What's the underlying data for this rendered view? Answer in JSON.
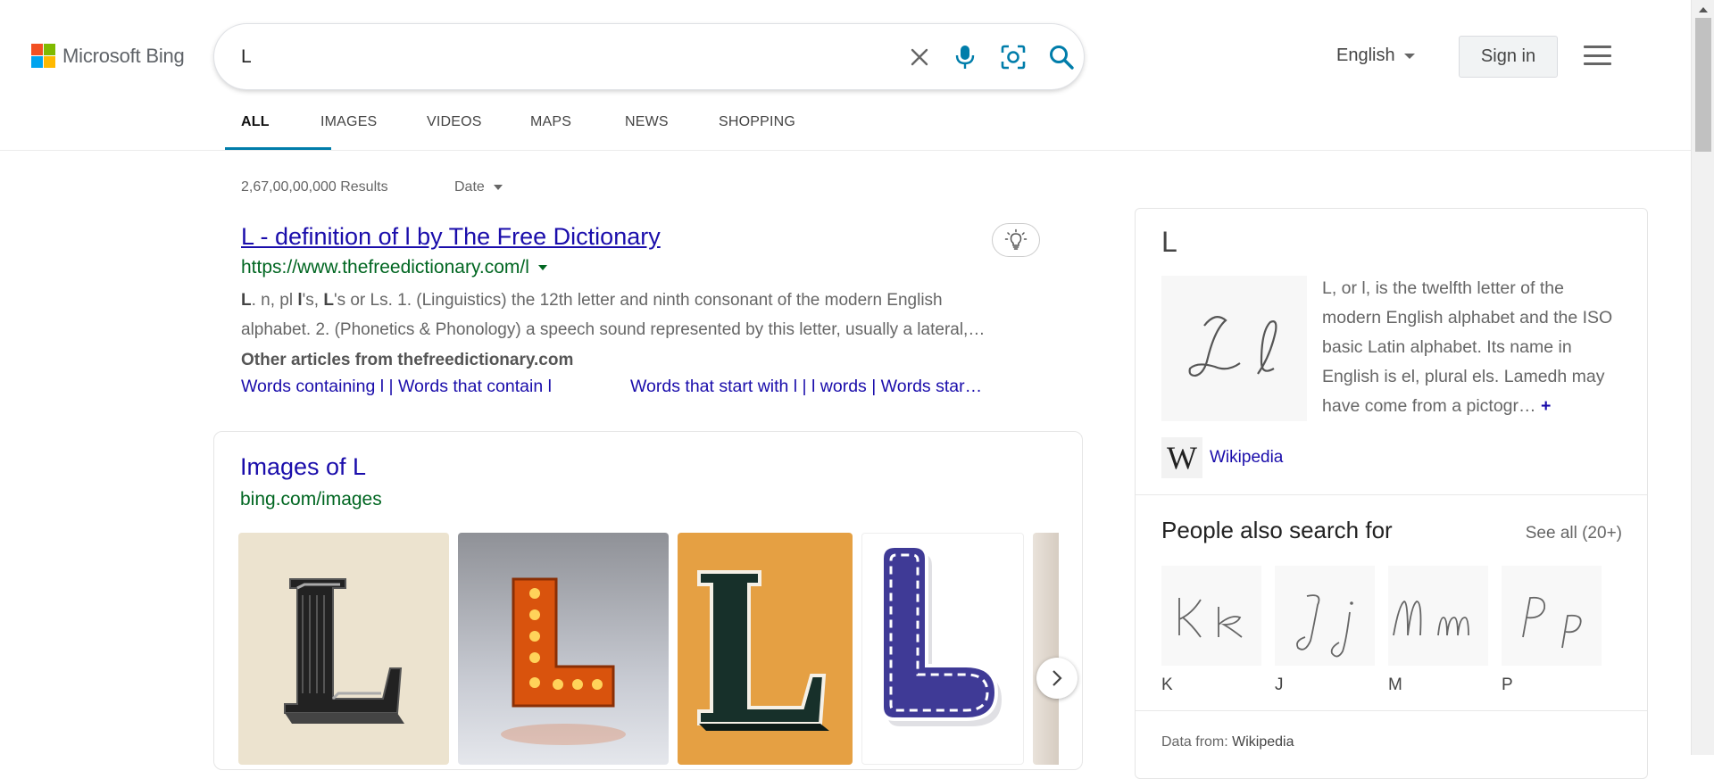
{
  "brand": {
    "name": "Microsoft Bing",
    "colors": [
      "#f25022",
      "#7fba00",
      "#00a4ef",
      "#ffb900"
    ]
  },
  "search": {
    "query": "L",
    "clear_icon": "close-icon",
    "mic_icon": "microphone-icon",
    "visual_icon": "visual-search-icon",
    "search_icon": "search-icon"
  },
  "header": {
    "language": "English",
    "signin": "Sign in",
    "menu_icon": "hamburger-menu-icon"
  },
  "tabs": [
    {
      "label": "ALL",
      "active": true
    },
    {
      "label": "IMAGES",
      "active": false
    },
    {
      "label": "VIDEOS",
      "active": false
    },
    {
      "label": "MAPS",
      "active": false
    },
    {
      "label": "NEWS",
      "active": false
    },
    {
      "label": "SHOPPING",
      "active": false
    }
  ],
  "results": {
    "count": "2,67,00,00,000 Results",
    "date_filter": "Date",
    "first": {
      "title": "L - definition of l by The Free Dictionary",
      "url": "https://www.thefreedictionary.com/l",
      "snippet_line1_a": "L",
      "snippet_line1_b": ". n, pl ",
      "snippet_line1_c": "l",
      "snippet_line1_d": "'s, ",
      "snippet_line1_e": "L",
      "snippet_line1_f": "'s or Ls. 1. (Linguistics) the 12th letter and ninth consonant of the modern English",
      "snippet_line2": "alphabet. 2. (Phonetics & Phonology) a speech sound represented by this letter, usually a lateral,…",
      "other_heading": "Other articles from thefreedictionary.com",
      "other_link1": "Words containing l | Words that contain l",
      "other_link2": "Words that start with l | l words | Words star…",
      "bulb_icon": "lightbulb-icon"
    },
    "images": {
      "title": "Images of L",
      "url": "bing.com/images",
      "next_icon": "chevron-right-icon"
    }
  },
  "knowledge_panel": {
    "title": "L",
    "description": "L, or l, is the twelfth letter of the modern English alphabet and the ISO basic Latin alphabet. Its name in English is el, plural els. Lamedh may have come from a pictogr…",
    "more": "+",
    "source_link": "Wikipedia",
    "people_also_search": {
      "heading": "People also search for",
      "see_all": "See all (20+)",
      "items": [
        {
          "label": "K",
          "glyph": "Kk"
        },
        {
          "label": "J",
          "glyph": "Jj"
        },
        {
          "label": "M",
          "glyph": "Mm"
        },
        {
          "label": "P",
          "glyph": "Pp"
        }
      ]
    },
    "data_from_label": "Data from: ",
    "data_from_source": "Wikipedia"
  }
}
